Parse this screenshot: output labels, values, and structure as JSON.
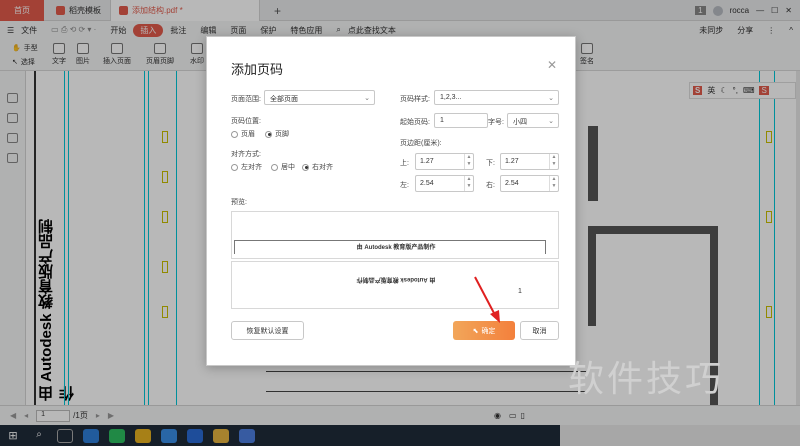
{
  "tabs": {
    "home": "首页",
    "template": "稻壳模板",
    "file": "添加结构.pdf *",
    "add": "+"
  },
  "window": {
    "badge": "1",
    "user": "rocca"
  },
  "menu": {
    "file": "文件",
    "items": [
      "开始",
      "插入",
      "批注",
      "编辑",
      "页面",
      "保护",
      "特色应用"
    ],
    "active": "插入",
    "search": "点此查找文本",
    "sync": "未同步",
    "share": "分享"
  },
  "toolbar": {
    "hand": "手型",
    "select": "选择",
    "text": "文字",
    "image": "图片",
    "insert_page": "插入页面",
    "header_footer": "页眉页脚",
    "watermark": "水印",
    "sign": "签名"
  },
  "dialog": {
    "title": "添加页码",
    "close": "✕",
    "range_label": "页面范围:",
    "range_value": "全部页面",
    "position_label": "页码位置:",
    "pos_header": "页眉",
    "pos_footer": "页脚",
    "align_label": "对齐方式:",
    "align_left": "左对齐",
    "align_center": "居中",
    "align_right": "右对齐",
    "style_label": "页码样式:",
    "style_value": "1,2,3...",
    "start_label": "起始页码:",
    "start_value": "1",
    "font_label": "字号:",
    "font_value": "小四",
    "margin_label": "页边距(厘米):",
    "top_label": "上:",
    "top_value": "1.27",
    "bottom_label": "下:",
    "bottom_value": "1.27",
    "left_label": "左:",
    "left_value": "2.54",
    "right_label": "右:",
    "right_value": "2.54",
    "preview_label": "预览:",
    "preview_text": "由 Autodesk 教育版产品制作",
    "preview_page_num": "1",
    "reset": "恢复默认设置",
    "ok": "确定",
    "cancel": "取消"
  },
  "page_side_text": "由 Autodesk 教育版产品制作",
  "status": {
    "page": "1",
    "total": "/1页"
  },
  "watermark": "软件技巧",
  "sogou": {
    "label": "英"
  },
  "accent": "#e25b4c"
}
